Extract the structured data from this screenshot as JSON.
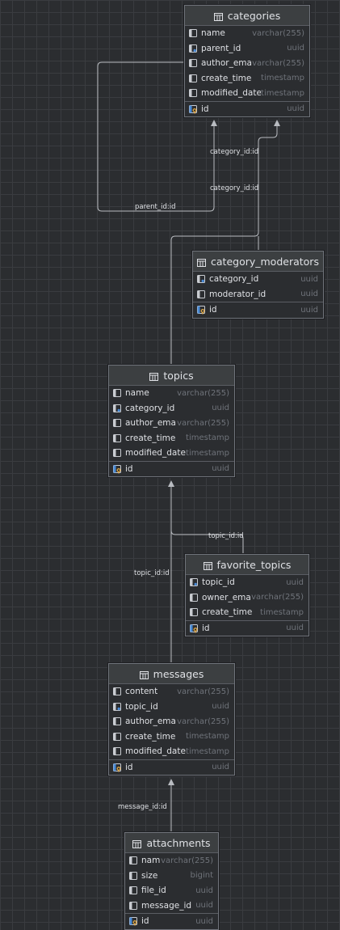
{
  "tables": {
    "categories": {
      "name": "categories",
      "columns": [
        {
          "name": "name",
          "type": "varchar(255)",
          "icon": "column-icon"
        },
        {
          "name": "parent_id",
          "type": "uuid",
          "icon": "foreign-key-column-icon"
        },
        {
          "name": "author_email",
          "type": "varchar(255)",
          "icon": "column-icon"
        },
        {
          "name": "create_time",
          "type": "timestamp",
          "icon": "column-icon"
        },
        {
          "name": "modified_date",
          "type": "timestamp",
          "icon": "column-icon"
        },
        {
          "name": "id",
          "type": "uuid",
          "icon": "primary-key-icon"
        }
      ]
    },
    "category_moderators": {
      "name": "category_moderators",
      "columns": [
        {
          "name": "category_id",
          "type": "uuid",
          "icon": "foreign-key-column-icon"
        },
        {
          "name": "moderator_id",
          "type": "uuid",
          "icon": "column-icon"
        },
        {
          "name": "id",
          "type": "uuid",
          "icon": "primary-key-icon"
        }
      ]
    },
    "topics": {
      "name": "topics",
      "columns": [
        {
          "name": "name",
          "type": "varchar(255)",
          "icon": "column-icon"
        },
        {
          "name": "category_id",
          "type": "uuid",
          "icon": "foreign-key-column-icon"
        },
        {
          "name": "author_email",
          "type": "varchar(255)",
          "icon": "column-icon"
        },
        {
          "name": "create_time",
          "type": "timestamp",
          "icon": "column-icon"
        },
        {
          "name": "modified_date",
          "type": "timestamp",
          "icon": "column-icon"
        },
        {
          "name": "id",
          "type": "uuid",
          "icon": "primary-key-icon"
        }
      ]
    },
    "favorite_topics": {
      "name": "favorite_topics",
      "columns": [
        {
          "name": "topic_id",
          "type": "uuid",
          "icon": "foreign-key-column-icon"
        },
        {
          "name": "owner_email",
          "type": "varchar(255)",
          "icon": "column-icon"
        },
        {
          "name": "create_time",
          "type": "timestamp",
          "icon": "column-icon"
        },
        {
          "name": "id",
          "type": "uuid",
          "icon": "primary-key-icon"
        }
      ]
    },
    "messages": {
      "name": "messages",
      "columns": [
        {
          "name": "content",
          "type": "varchar(255)",
          "icon": "column-icon"
        },
        {
          "name": "topic_id",
          "type": "uuid",
          "icon": "foreign-key-column-icon"
        },
        {
          "name": "author_email",
          "type": "varchar(255)",
          "icon": "column-icon"
        },
        {
          "name": "create_time",
          "type": "timestamp",
          "icon": "column-icon"
        },
        {
          "name": "modified_date",
          "type": "timestamp",
          "icon": "column-icon"
        },
        {
          "name": "id",
          "type": "uuid",
          "icon": "primary-key-icon"
        }
      ]
    },
    "attachments": {
      "name": "attachments",
      "columns": [
        {
          "name": "name",
          "type": "varchar(255)",
          "icon": "column-icon"
        },
        {
          "name": "size",
          "type": "bigint",
          "icon": "column-icon"
        },
        {
          "name": "file_id",
          "type": "uuid",
          "icon": "column-icon"
        },
        {
          "name": "message_id",
          "type": "uuid",
          "icon": "column-icon"
        },
        {
          "name": "id",
          "type": "uuid",
          "icon": "primary-key-icon"
        }
      ]
    }
  },
  "relations": {
    "categories_parent": "parent_id:id",
    "topics_category": "category_id:id",
    "moderators_category": "category_id:id",
    "favorite_topic": "topic_id:id",
    "messages_topic": "topic_id:id",
    "attachments_message": "message_id:id"
  },
  "colors": {
    "background": "#2b2d30",
    "table_border": "#6f737a",
    "header": "#3c3f41",
    "text": "#dfe1e5",
    "type_text": "#6f737a",
    "key_gold": "#d9a343",
    "fk_blue": "#4a8bd6",
    "line": "#b9bcc1"
  }
}
